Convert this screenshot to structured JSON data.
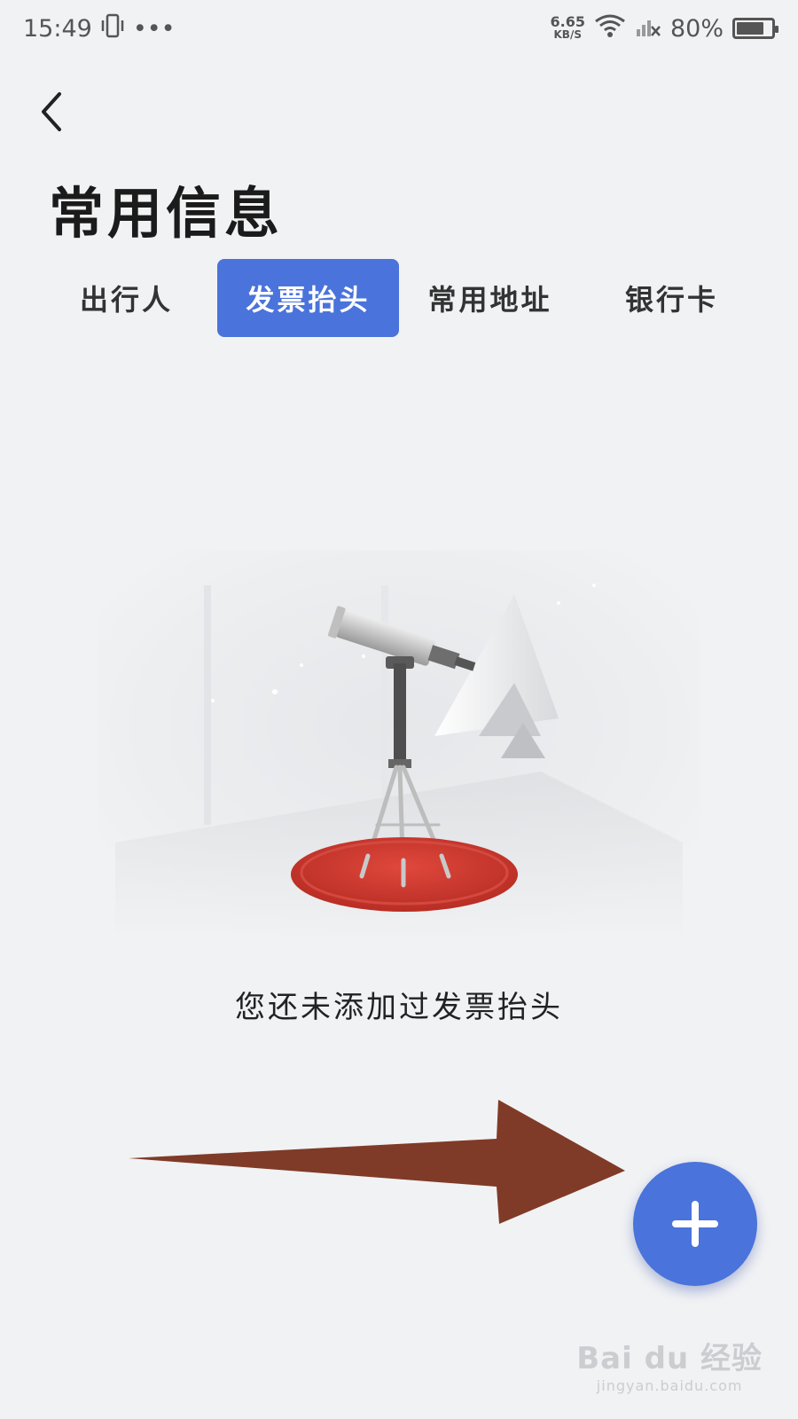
{
  "status_bar": {
    "time": "15:49",
    "more": "•••",
    "net_speed": "6.65",
    "net_unit": "KB/S",
    "battery": "80%",
    "battery_level": 0.8
  },
  "header": {
    "title": "常用信息"
  },
  "tabs": [
    {
      "label": "出行人",
      "active": false
    },
    {
      "label": "发票抬头",
      "active": true
    },
    {
      "label": "常用地址",
      "active": false
    },
    {
      "label": "银行卡",
      "active": false
    }
  ],
  "empty_state": {
    "message": "您还未添加过发票抬头",
    "illustration": "telescope-illustration"
  },
  "fab": {
    "icon": "plus-icon"
  },
  "annotation": {
    "arrow_color": "#7f3b27"
  },
  "watermark": {
    "brand": "Bai du 经验",
    "url": "jingyan.baidu.com"
  },
  "colors": {
    "accent": "#4a73db",
    "background": "#f1f2f4"
  }
}
